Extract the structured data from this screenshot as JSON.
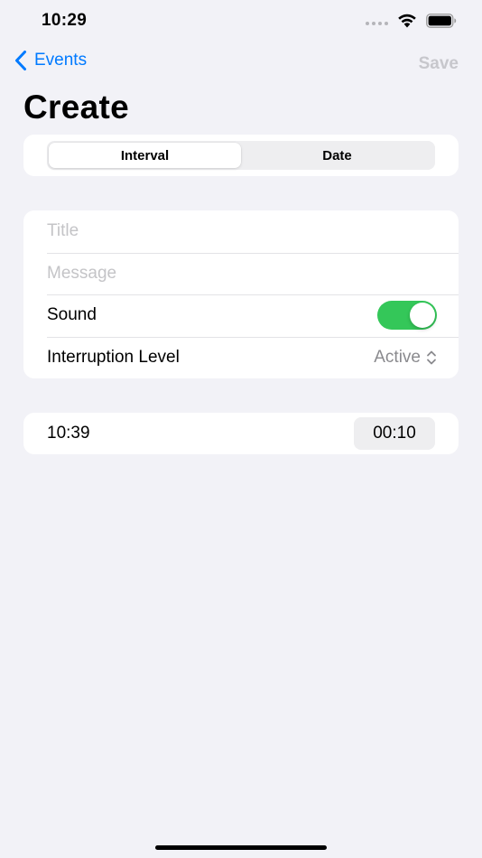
{
  "status_bar": {
    "time": "10:29"
  },
  "nav": {
    "back_label": "Events",
    "save_label": "Save"
  },
  "title": "Create",
  "segments": {
    "selected": "Interval",
    "items": [
      "Interval",
      "Date"
    ]
  },
  "form": {
    "title_placeholder": "Title",
    "message_placeholder": "Message",
    "sound_label": "Sound",
    "sound_on": true,
    "interruption_label": "Interruption Level",
    "interruption_value": "Active"
  },
  "time": {
    "label": "10:39",
    "duration": "00:10"
  },
  "colors": {
    "accent": "#007aff",
    "toggle_on": "#34c759",
    "background": "#f2f2f7",
    "disabled": "#c7c7cc"
  },
  "icons": {
    "back": "chevron-left-icon",
    "signal": "signal-dots-icon",
    "wifi": "wifi-icon",
    "battery": "battery-icon",
    "picker": "chevron-up-down-icon"
  }
}
